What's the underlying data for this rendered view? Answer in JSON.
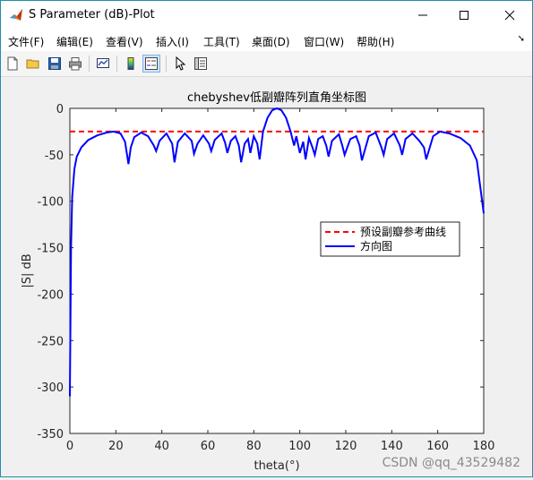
{
  "window": {
    "title": "S Parameter (dB)-Plot"
  },
  "menu": [
    "文件(F)",
    "编辑(E)",
    "查看(V)",
    "插入(I)",
    "工具(T)",
    "桌面(D)",
    "窗口(W)",
    "帮助(H)"
  ],
  "toolbar": {
    "icons": [
      "new-figure-icon",
      "open-file-icon",
      "save-icon",
      "print-icon",
      "link-plot-icon",
      "colorbar-icon",
      "legend-icon",
      "pointer-icon",
      "property-inspector-icon"
    ]
  },
  "watermark": "CSDN @qq_43529482",
  "chart_data": {
    "type": "line",
    "title": "chebyshev低副瓣阵列直角坐标图",
    "xlabel": "theta(°)",
    "ylabel": "|S| dB",
    "xlim": [
      0,
      180
    ],
    "ylim": [
      -350,
      0
    ],
    "xticks": [
      "0",
      "20",
      "40",
      "60",
      "80",
      "100",
      "120",
      "140",
      "160",
      "180"
    ],
    "yticks": [
      "0",
      "-50",
      "-100",
      "-150",
      "-200",
      "-250",
      "-300",
      "-350"
    ],
    "grid": false,
    "legend_position": "right-middle",
    "series": [
      {
        "name": "预设副瓣参考曲线",
        "color": "#ff0000",
        "style": "dashed",
        "x": [
          0,
          180
        ],
        "y": [
          -25,
          -25
        ]
      },
      {
        "name": "方向图",
        "color": "#0000ff",
        "style": "solid",
        "x": [
          0,
          0.5,
          1,
          2,
          3,
          5,
          8,
          12,
          16,
          19,
          22,
          24,
          25.5,
          26.5,
          28,
          31,
          34,
          36.5,
          37.5,
          39,
          42,
          44.5,
          45.5,
          47,
          50,
          53,
          54,
          55.5,
          58,
          60.5,
          61.5,
          63,
          66,
          67.5,
          68.5,
          70,
          72,
          73.5,
          74.5,
          76,
          77.5,
          78.5,
          80,
          81.5,
          82.5,
          84,
          86,
          88,
          90,
          92,
          94,
          96,
          97.5,
          98.5,
          100,
          101.5,
          102.5,
          104,
          105.5,
          106.5,
          108,
          110,
          111.5,
          112.5,
          114,
          117,
          118.5,
          119.5,
          122,
          124.5,
          126,
          127,
          130,
          133,
          135.5,
          136.5,
          138,
          141,
          143.5,
          144.5,
          146,
          149,
          152,
          154,
          155,
          158,
          161,
          165,
          170,
          174,
          177,
          178.5,
          180
        ],
        "y": [
          -310,
          -150,
          -95,
          -65,
          -52,
          -42,
          -34,
          -29,
          -26,
          -25,
          -27,
          -36,
          -60,
          -42,
          -31,
          -26,
          -30,
          -40,
          -46,
          -35,
          -27,
          -38,
          -58,
          -36,
          -27,
          -35,
          -49,
          -38,
          -29,
          -38,
          -46,
          -34,
          -27,
          -37,
          -48,
          -35,
          -30,
          -40,
          -58,
          -38,
          -33,
          -48,
          -30,
          -38,
          -55,
          -25,
          -10,
          -2,
          0,
          -2,
          -10,
          -25,
          -40,
          -30,
          -48,
          -36,
          -55,
          -32,
          -42,
          -50,
          -33,
          -30,
          -40,
          -52,
          -35,
          -28,
          -40,
          -50,
          -33,
          -30,
          -40,
          -56,
          -30,
          -26,
          -42,
          -50,
          -33,
          -27,
          -40,
          -50,
          -33,
          -27,
          -35,
          -42,
          -55,
          -30,
          -25,
          -27,
          -32,
          -40,
          -56,
          -85,
          -113
        ]
      }
    ]
  }
}
